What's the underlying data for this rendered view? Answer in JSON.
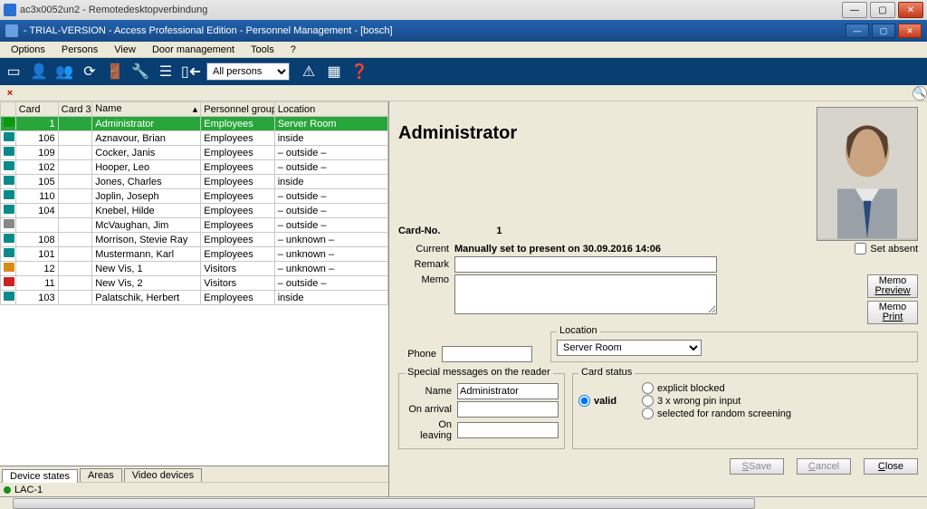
{
  "rdp": {
    "title": "ac3x0052un2 - Remotedesktopverbindung"
  },
  "app": {
    "title": "- TRIAL-VERSION - Access Professional Edition - Personnel Management - [bosch]",
    "menus": [
      "Options",
      "Persons",
      "View",
      "Door management",
      "Tools",
      "?"
    ]
  },
  "toolbar": {
    "filter": "All persons"
  },
  "grid": {
    "headers": {
      "card": "Card",
      "card3": "Card 3",
      "name": "Name",
      "group": "Personnel group",
      "location": "Location"
    },
    "rows": [
      {
        "marker": "m-green-dot",
        "card": "1",
        "card3": "",
        "name": "Administrator",
        "group": "Employees",
        "loc": "Server Room",
        "selected": true
      },
      {
        "marker": "m-teal",
        "card": "106",
        "card3": "",
        "name": "Aznavour, Brian",
        "group": "Employees",
        "loc": "inside"
      },
      {
        "marker": "m-teal",
        "card": "109",
        "card3": "",
        "name": "Cocker, Janis",
        "group": "Employees",
        "loc": "– outside –"
      },
      {
        "marker": "m-teal",
        "card": "102",
        "card3": "",
        "name": "Hooper, Leo",
        "group": "Employees",
        "loc": "– outside –"
      },
      {
        "marker": "m-teal",
        "card": "105",
        "card3": "",
        "name": "Jones, Charles",
        "group": "Employees",
        "loc": "inside"
      },
      {
        "marker": "m-teal",
        "card": "110",
        "card3": "",
        "name": "Joplin, Joseph",
        "group": "Employees",
        "loc": "– outside –"
      },
      {
        "marker": "m-teal",
        "card": "104",
        "card3": "",
        "name": "Knebel, Hilde",
        "group": "Employees",
        "loc": "– outside –"
      },
      {
        "marker": "m-grey",
        "card": "",
        "card3": "",
        "name": "McVaughan, Jim",
        "group": "Employees",
        "loc": "– outside –"
      },
      {
        "marker": "m-teal",
        "card": "108",
        "card3": "",
        "name": "Morrison, Stevie Ray",
        "group": "Employees",
        "loc": "– unknown –"
      },
      {
        "marker": "m-teal",
        "card": "101",
        "card3": "",
        "name": "Mustermann, Karl",
        "group": "Employees",
        "loc": "– unknown –"
      },
      {
        "marker": "m-orange",
        "card": "12",
        "card3": "",
        "name": "New Vis, 1",
        "group": "Visitors",
        "loc": "– unknown –"
      },
      {
        "marker": "m-red",
        "card": "11",
        "card3": "",
        "name": "New Vis, 2",
        "group": "Visitors",
        "loc": "– outside –"
      },
      {
        "marker": "m-teal",
        "card": "103",
        "card3": "",
        "name": "Palatschik, Herbert",
        "group": "Employees",
        "loc": "inside"
      }
    ]
  },
  "tabs": {
    "devices": "Device states",
    "areas": "Areas",
    "video": "Video devices"
  },
  "status": {
    "text": "LAC-1"
  },
  "detail": {
    "name": "Administrator",
    "cardno_label": "Card-No.",
    "cardno_value": "1",
    "current_label": "Current",
    "current_value": "Manually set to present on 30.09.2016 14:06",
    "set_absent": "Set absent",
    "remark_label": "Remark",
    "memo_label": "Memo",
    "memo_preview_l1": "Memo",
    "memo_preview_l2": "Preview",
    "memo_print_l1": "Memo",
    "memo_print_l2": "Print",
    "phone_label": "Phone",
    "location_legend": "Location",
    "location_value": "Server Room",
    "cardstatus_legend": "Card status",
    "status_valid": "valid",
    "status_blocked": "explicit blocked",
    "status_3wrong": "3 x wrong pin input",
    "status_screening": "selected for random screening",
    "reader_legend": "Special messages on the reader",
    "reader_name_label": "Name",
    "reader_name_value": "Administrator",
    "reader_arrival": "On arrival",
    "reader_leaving": "On leaving",
    "save": "Save",
    "cancel": "Cancel",
    "close": "Close"
  }
}
